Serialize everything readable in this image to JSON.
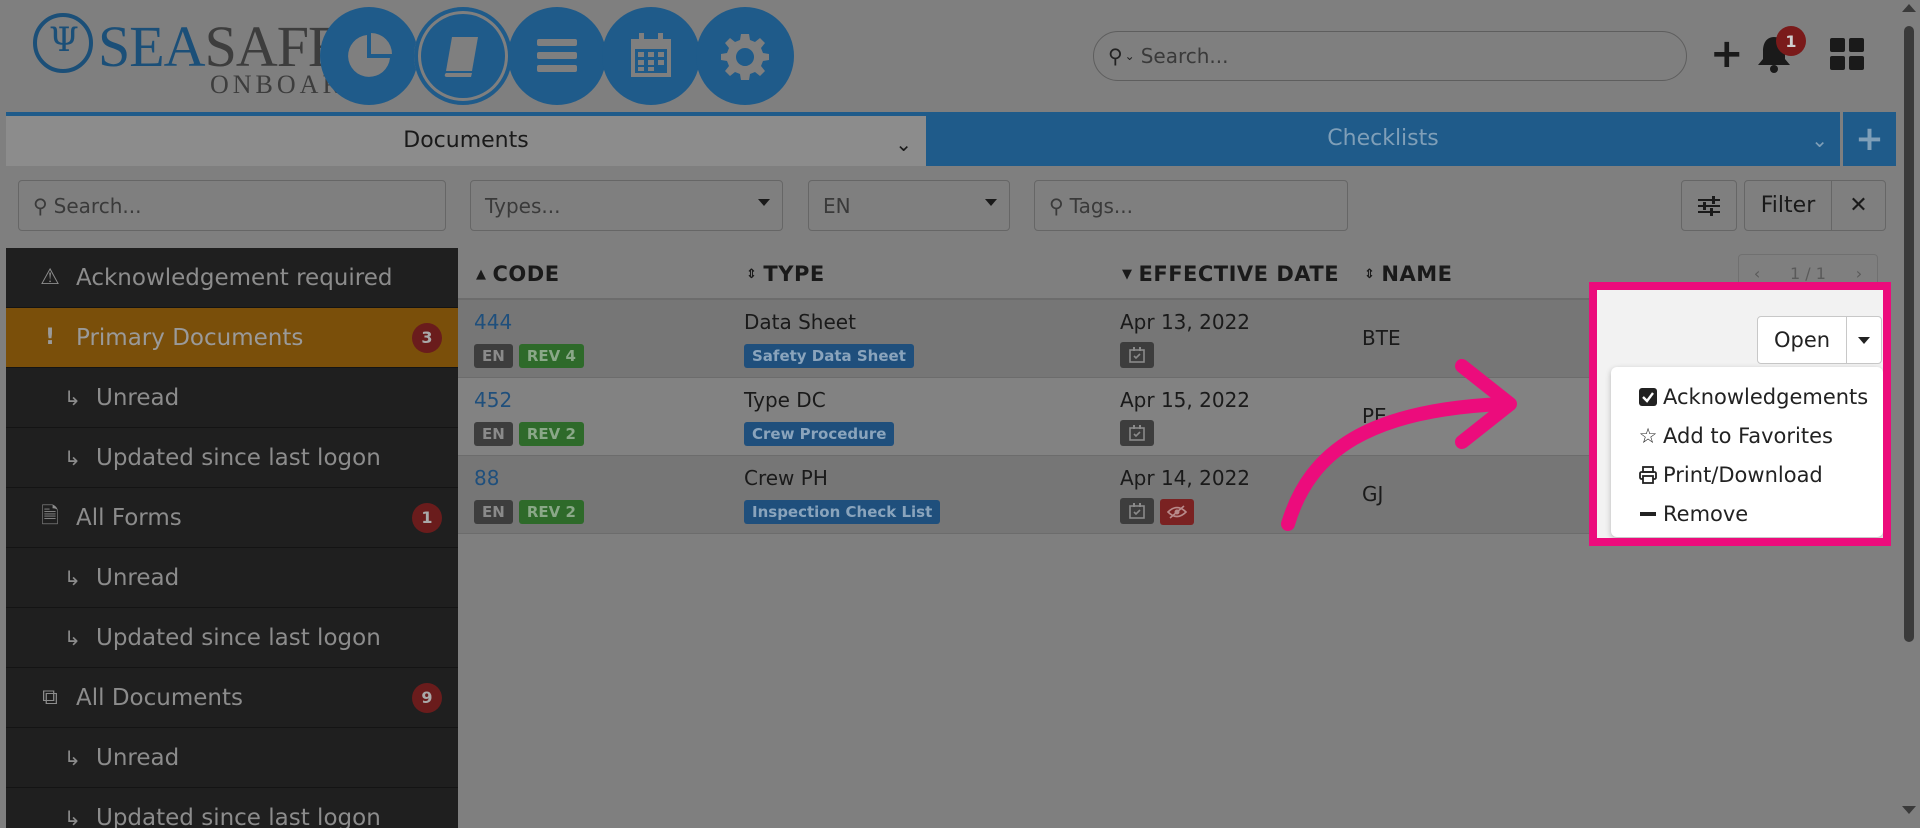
{
  "logo": {
    "sea": "SEA",
    "safe": "SAFE",
    "onboard": "ONBOARD"
  },
  "nav": [
    {
      "name": "dashboard-pie-icon"
    },
    {
      "name": "book-icon"
    },
    {
      "name": "menu-icon"
    },
    {
      "name": "calendar-icon"
    },
    {
      "name": "gear-icon"
    }
  ],
  "top_search": {
    "placeholder": "Search..."
  },
  "notifications": {
    "count": "1"
  },
  "tabs": {
    "documents": "Documents",
    "checklists": "Checklists"
  },
  "filters": {
    "search_placeholder": "Search...",
    "types_placeholder": "Types...",
    "language": "EN",
    "tags_placeholder": "Tags...",
    "filter_label": "Filter"
  },
  "sidebar": {
    "items": [
      {
        "label": "Acknowledgement required",
        "icon": "warning-icon"
      },
      {
        "label": "Primary Documents",
        "icon": "exclamation-icon",
        "badge": "3"
      },
      {
        "label": "Unread",
        "sub": true
      },
      {
        "label": "Updated since last logon",
        "sub": true
      },
      {
        "label": "All Forms",
        "icon": "file-icon",
        "badge": "1"
      },
      {
        "label": "Unread",
        "sub": true
      },
      {
        "label": "Updated since last logon",
        "sub": true
      },
      {
        "label": "All Documents",
        "icon": "copy-icon",
        "badge": "9"
      },
      {
        "label": "Unread",
        "sub": true
      },
      {
        "label": "Updated since last logon",
        "sub": true
      }
    ]
  },
  "table": {
    "headers": {
      "code": "CODE",
      "type": "TYPE",
      "effective_date": "EFFECTIVE DATE",
      "name": "NAME"
    },
    "pager": "1 / 1",
    "rows": [
      {
        "code": "444",
        "lang": "EN",
        "rev": "REV 4",
        "type": "Data Sheet",
        "type_tag": "Safety Data Sheet",
        "date": "Apr 13, 2022",
        "name": "BTE",
        "hidden": false
      },
      {
        "code": "452",
        "lang": "EN",
        "rev": "REV 2",
        "type": "Type DC",
        "type_tag": "Crew Procedure",
        "date": "Apr 15, 2022",
        "name": "PE",
        "hidden": false
      },
      {
        "code": "88",
        "lang": "EN",
        "rev": "REV 2",
        "type": "Crew PH",
        "type_tag": "Inspection Check List",
        "date": "Apr 14, 2022",
        "name": "GJ",
        "hidden": true
      }
    ]
  },
  "row_actions": {
    "open_label": "Open",
    "menu": [
      {
        "label": "Acknowledgements",
        "icon": "checkbox-icon"
      },
      {
        "label": "Add to Favorites",
        "icon": "star-icon"
      },
      {
        "label": "Print/Download",
        "icon": "print-icon"
      },
      {
        "label": "Remove",
        "icon": "minus-icon"
      }
    ]
  },
  "colors": {
    "accent": "#ec0c7c",
    "brand": "#1f5b8a",
    "active": "#7a4f0a"
  }
}
